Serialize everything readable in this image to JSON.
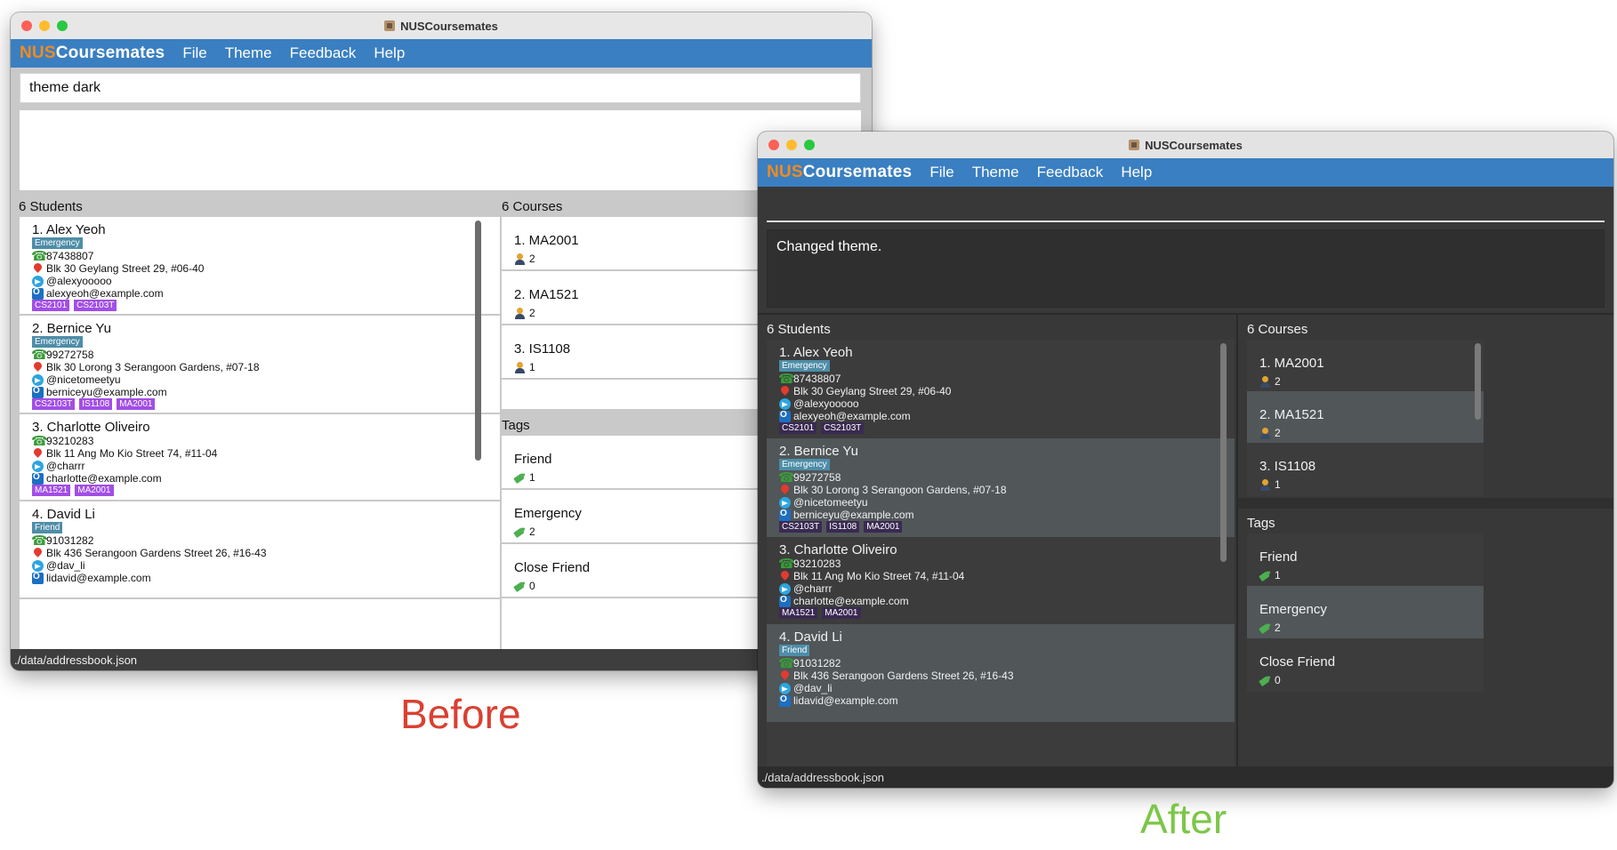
{
  "app": {
    "title": "NUSCoursemates",
    "logo_nus": "NUS",
    "logo_rest": "Coursemates",
    "menu": [
      "File",
      "Theme",
      "Feedback",
      "Help"
    ],
    "status_path": "./data/addressbook.json"
  },
  "before": {
    "caption": "Before",
    "command_text": "theme dark",
    "result_text": "",
    "students_label": "6 Students",
    "courses_label": "6 Courses",
    "tags_label": "Tags"
  },
  "after": {
    "caption": "After",
    "command_text": "",
    "result_text": "Changed theme.",
    "students_label": "6 Students",
    "courses_label": "6 Courses",
    "tags_label": "Tags"
  },
  "students": [
    {
      "name": "1.  Alex Yeoh",
      "label": "Emergency",
      "phone": "87438807",
      "address": "Blk 30 Geylang Street 29, #06-40",
      "telegram": "@alexyooooo",
      "email": "alexyeoh@example.com",
      "courses": [
        "CS2101",
        "CS2103T"
      ]
    },
    {
      "name": "2.  Bernice Yu",
      "label": "Emergency",
      "phone": "99272758",
      "address": "Blk 30 Lorong 3 Serangoon Gardens, #07-18",
      "telegram": "@nicetomeetyu",
      "email": "berniceyu@example.com",
      "courses": [
        "CS2103T",
        "IS1108",
        "MA2001"
      ]
    },
    {
      "name": "3.  Charlotte Oliveiro",
      "label": "",
      "phone": "93210283",
      "address": "Blk 11 Ang Mo Kio Street 74, #11-04",
      "telegram": "@charrr",
      "email": "charlotte@example.com",
      "courses": [
        "MA1521",
        "MA2001"
      ]
    },
    {
      "name": "4.  David Li",
      "label": "Friend",
      "phone": "91031282",
      "address": "Blk 436 Serangoon Gardens Street 26, #16-43",
      "telegram": "@dav_li",
      "email": "lidavid@example.com",
      "courses": []
    }
  ],
  "courses": [
    {
      "name": "1.  MA2001",
      "count": "2"
    },
    {
      "name": "2.  MA1521",
      "count": "2"
    },
    {
      "name": "3.  IS1108",
      "count": "1"
    }
  ],
  "tags": [
    {
      "name": "Friend",
      "count": "1"
    },
    {
      "name": "Emergency",
      "count": "2"
    },
    {
      "name": "Close Friend",
      "count": "0"
    }
  ],
  "colors": {
    "menubar": "#3a7fc1",
    "logo_orange": "#f28a1f",
    "course_tag_light": "#a24ee6",
    "course_tag_dark": "#3a2a52",
    "label_tag": "#4e8da8",
    "before_caption": "#d94032",
    "after_caption": "#7cc649"
  }
}
